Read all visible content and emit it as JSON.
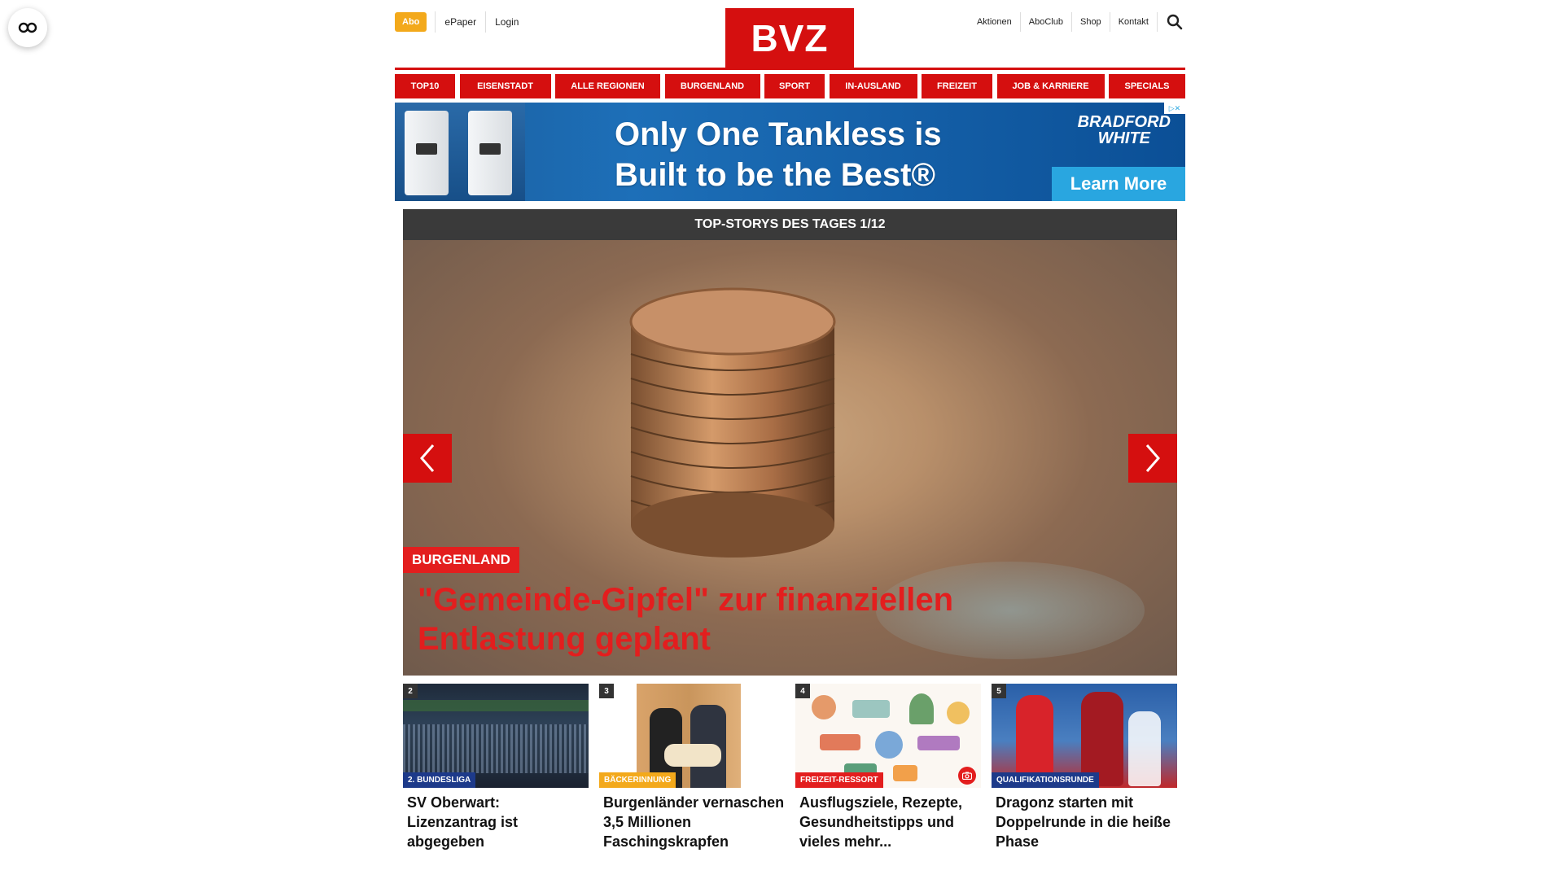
{
  "header": {
    "abo": "Abo",
    "left_links": [
      "ePaper",
      "Login"
    ],
    "logo": "BVZ",
    "right_links": [
      "Aktionen",
      "AboClub",
      "Shop",
      "Kontakt"
    ]
  },
  "nav": [
    "TOP10",
    "EISENSTADT",
    "ALLE REGIONEN",
    "BURGENLAND",
    "SPORT",
    "IN-AUSLAND",
    "FREIZEIT",
    "JOB & KARRIERE",
    "SPECIALS"
  ],
  "ad": {
    "headline_line1": "Only One Tankless is",
    "headline_line2": "Built to be the Best®",
    "brand_line1": "BRADFORD",
    "brand_line2": "WHITE",
    "cta": "Learn More"
  },
  "slider": {
    "heading": "TOP-STORYS DES TAGES 1/12",
    "category": "BURGENLAND",
    "headline": "\"Gemeinde-Gipfel\" zur finanziellen Entlastung geplant"
  },
  "teasers": [
    {
      "num": "2",
      "category": "2. BUNDESLIGA",
      "cat_color": "#1d3a8a",
      "title": "SV Oberwart: Lizenzantrag ist abgegeben"
    },
    {
      "num": "3",
      "category": "BÄCKERINNUNG",
      "cat_color": "#f3a91b",
      "title": "Burgenländer vernaschen 3,5 Millionen Faschingskrapfen"
    },
    {
      "num": "4",
      "category": "FREIZEIT-RESSORT",
      "cat_color": "#e31e1e",
      "title": "Ausflugsziele, Rezepte, Gesundheitstipps und vieles mehr..."
    },
    {
      "num": "5",
      "category": "QUALIFIKATIONSRUNDE",
      "cat_color": "#1d3a8a",
      "title": "Dragonz starten mit Doppelrunde in die heiße Phase"
    }
  ],
  "colors": {
    "brand_red": "#d50f0f",
    "abo_orange": "#f3a91b"
  }
}
